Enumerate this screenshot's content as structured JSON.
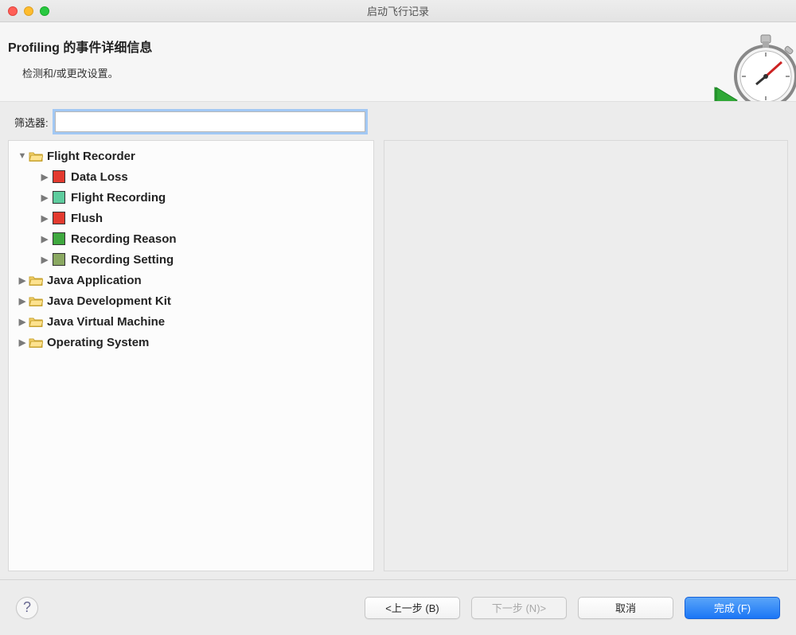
{
  "window": {
    "title": "启动飞行记录"
  },
  "header": {
    "title": "Profiling 的事件详细信息",
    "subtitle": "检测和/或更改设置。"
  },
  "filter": {
    "label": "筛选器:",
    "value": ""
  },
  "tree": {
    "root": {
      "label": "Flight Recorder",
      "expanded": true,
      "children": [
        {
          "label": "Data Loss",
          "color": "#e33a2f"
        },
        {
          "label": "Flight Recording",
          "color": "#5ecc9e"
        },
        {
          "label": "Flush",
          "color": "#e33a2f"
        },
        {
          "label": "Recording Reason",
          "color": "#3fa83f"
        },
        {
          "label": "Recording Setting",
          "color": "#8aa861"
        }
      ]
    },
    "folders": [
      {
        "label": "Java Application"
      },
      {
        "label": "Java Development Kit"
      },
      {
        "label": "Java Virtual Machine"
      },
      {
        "label": "Operating System"
      }
    ]
  },
  "buttons": {
    "back": "<上一步 (B)",
    "next": "下一步 (N)>",
    "cancel": "取消",
    "finish": "完成 (F)"
  }
}
